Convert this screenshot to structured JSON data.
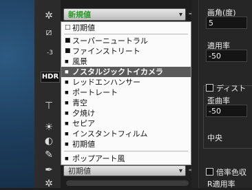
{
  "style_dropdown": {
    "selected": "新規値",
    "chevron_icon": "chevron-down-icon",
    "add_icon": "plus-icon"
  },
  "menu": {
    "items": [
      {
        "label": "初期値",
        "bullet": "□",
        "selected": false
      },
      {
        "label": "スーパーニュートラル",
        "bullet": "■",
        "selected": false
      },
      {
        "label": "ファインストリート",
        "bullet": "■",
        "selected": false
      },
      {
        "label": "風景",
        "bullet": "■",
        "selected": false
      },
      {
        "label": "ノスタルジックトイカメラ",
        "bullet": "■",
        "selected": true
      },
      {
        "label": "レッドエンハンサー",
        "bullet": "■",
        "selected": false
      },
      {
        "label": "ポートレート",
        "bullet": "■",
        "selected": false
      },
      {
        "label": "青空",
        "bullet": "■",
        "selected": false
      },
      {
        "label": "夕焼け",
        "bullet": "■",
        "selected": false
      },
      {
        "label": "セピア",
        "bullet": "■",
        "selected": false
      },
      {
        "label": "インスタントフィルム",
        "bullet": "■",
        "selected": false
      },
      {
        "label": "初期値",
        "bullet": "■",
        "selected": false
      },
      {
        "label": "ポップアート風",
        "bullet": "■",
        "selected": false
      }
    ]
  },
  "bottom_dropdown": {
    "selected": "初期値"
  },
  "toolbar": {
    "hdr": "HDR",
    "minus_value": "-3"
  },
  "right_panel": {
    "angle_label": "画角(度)",
    "angle_value": "5",
    "apply_rate_label": "適用率",
    "apply_rate_value": "-50",
    "distortion_label": "ディスト",
    "distortion_amount_label": "歪曲率",
    "distortion_amount_value": "-50",
    "center_label": "中央",
    "magnification_label": "倍率色収",
    "r_apply_label": "R適用率"
  },
  "colors": {
    "selected_text": "#2a9a2a",
    "menu_highlight": "#5a5a5a",
    "panel_bg": "#262626"
  }
}
